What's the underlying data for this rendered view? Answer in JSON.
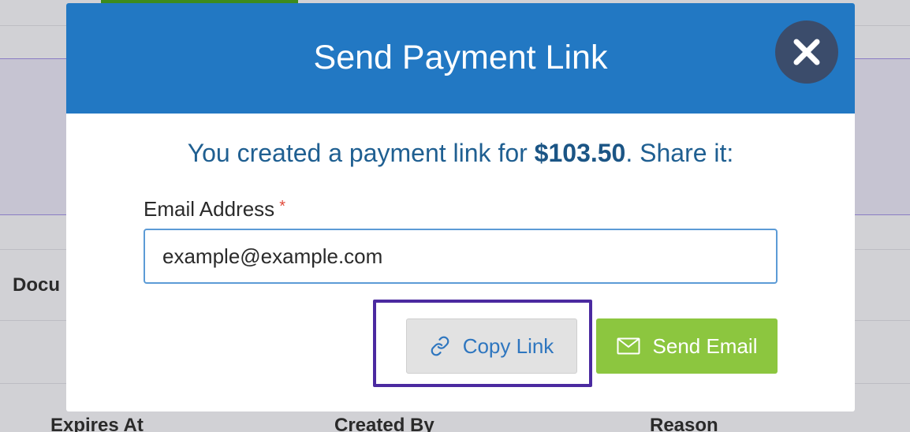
{
  "background": {
    "row_label_partial": "Docu",
    "columns": [
      "Expires At",
      "Created By",
      "Reason"
    ]
  },
  "modal": {
    "title": "Send Payment Link",
    "close_icon": "close-icon",
    "share_prefix": "You created a payment link for ",
    "amount": "$103.50",
    "share_suffix": ". Share it:",
    "email_label": "Email Address",
    "required_marker": "*",
    "email_value": "example@example.com",
    "copy_button": {
      "label": "Copy Link",
      "icon": "link-icon"
    },
    "send_button": {
      "label": "Send Email",
      "icon": "envelope-icon"
    }
  },
  "colors": {
    "header": "#2278c3",
    "close_button": "#3b4c6b",
    "send_button": "#8cc63f",
    "copy_button": "#e2e2e2",
    "highlight": "#4b2aa0"
  }
}
